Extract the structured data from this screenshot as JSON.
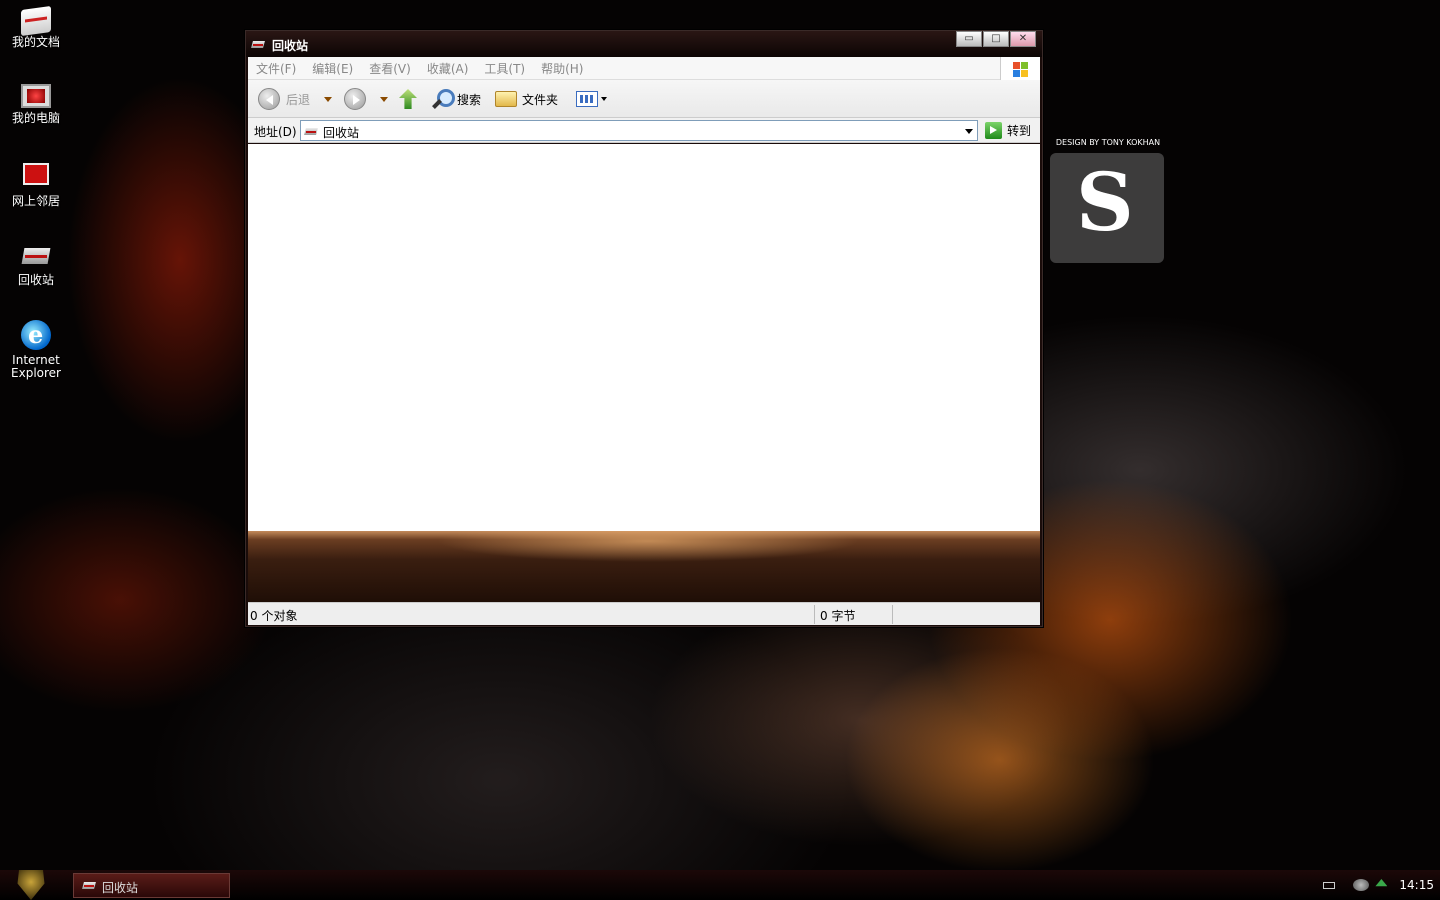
{
  "desktop": {
    "icons": [
      {
        "label": "我的文档",
        "icon": "my-documents-icon"
      },
      {
        "label": "我的电脑",
        "icon": "my-computer-icon"
      },
      {
        "label": "网上邻居",
        "icon": "network-places-icon"
      },
      {
        "label": "回收站",
        "icon": "recycle-bin-icon"
      },
      {
        "label_line1": "Internet",
        "label_line2": "Explorer",
        "icon": "internet-explorer-icon"
      }
    ],
    "branding": {
      "credit": "DESIGN BY TONY KOKHAN",
      "logo_text": "S"
    }
  },
  "window": {
    "title": "回收站",
    "controls": {
      "minimize": "▭",
      "maximize": "□",
      "close": "✕"
    },
    "menu": [
      "文件(F)",
      "编辑(E)",
      "查看(V)",
      "收藏(A)",
      "工具(T)",
      "帮助(H)"
    ],
    "toolbar": {
      "back": "后退",
      "search": "搜索",
      "folders": "文件夹"
    },
    "address": {
      "label": "地址(D)",
      "value": "回收站",
      "go": "转到"
    },
    "status": {
      "objects": "0 个对象",
      "size": "0 字节"
    }
  },
  "taskbar": {
    "task": "回收站",
    "clock": "14:15"
  },
  "colors": {
    "accent": "#c21a1a",
    "window_frame": "#1a0c0a"
  }
}
